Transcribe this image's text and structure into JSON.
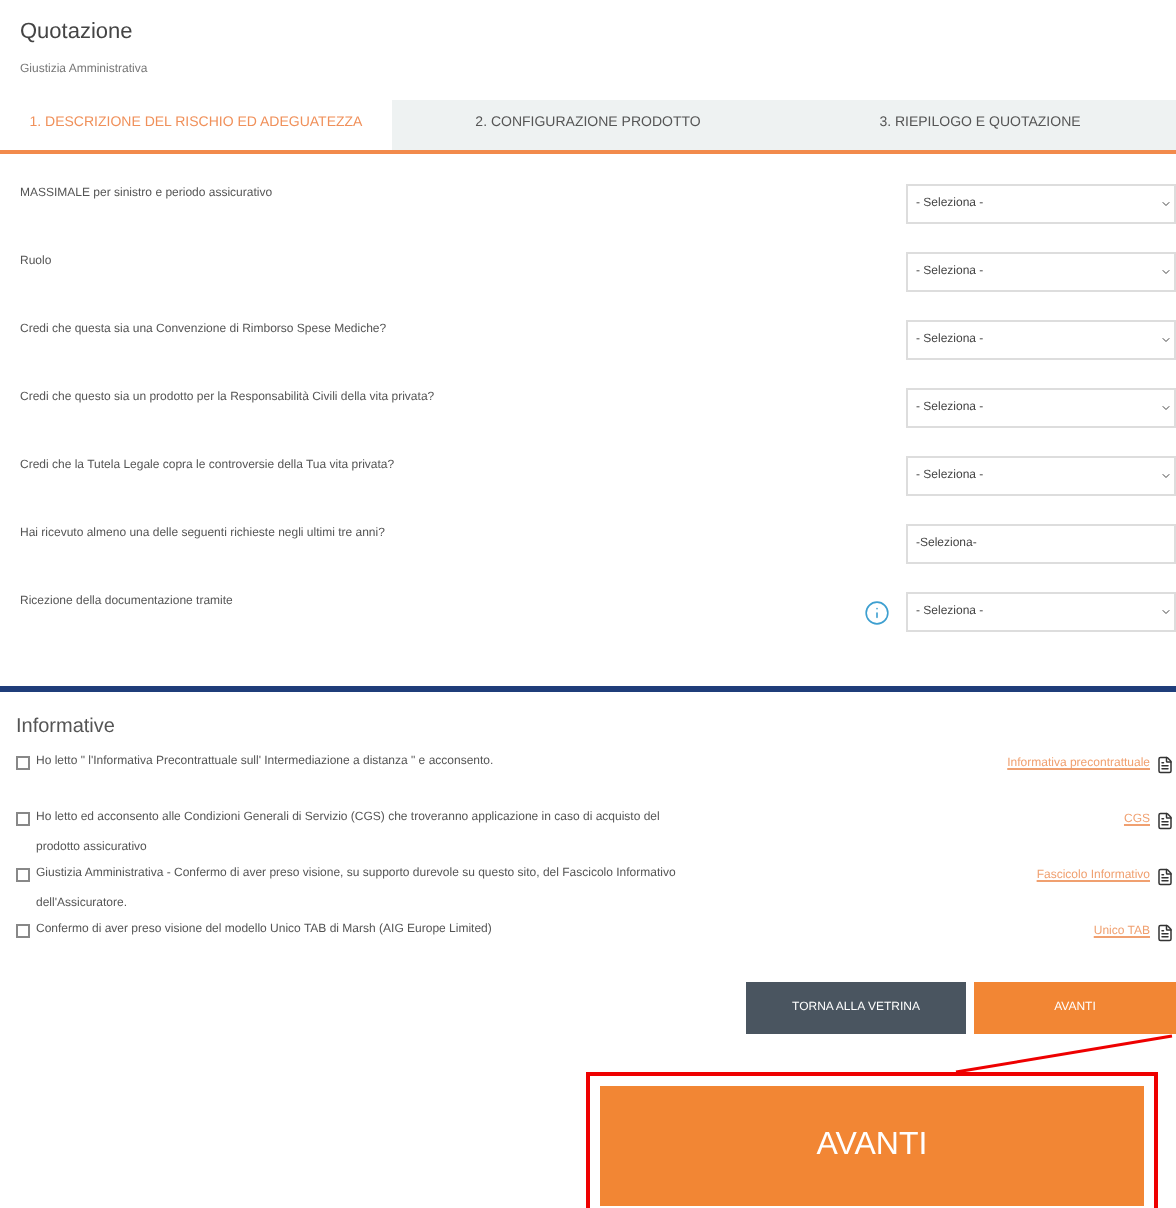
{
  "header": {
    "title": "Quotazione",
    "subtitle": "Giustizia Amministrativa"
  },
  "tabs": [
    {
      "label": "1. DESCRIZIONE DEL RISCHIO ED ADEGUATEZZA",
      "selected": true
    },
    {
      "label": "2. CONFIGURAZIONE PRODOTTO",
      "selected": false
    },
    {
      "label": "3. RIEPILOGO E QUOTAZIONE",
      "selected": false
    }
  ],
  "questions": [
    {
      "label": "MASSIMALE per sinistro e periodo assicurativo",
      "kind": "dropdown",
      "value": "- Seleziona -",
      "info": false
    },
    {
      "label": "Ruolo",
      "kind": "dropdown",
      "value": "- Seleziona -",
      "info": false
    },
    {
      "label": "Credi che questa sia una Convenzione di Rimborso Spese Mediche?",
      "kind": "dropdown",
      "value": "- Seleziona -",
      "info": false
    },
    {
      "label": "Credi che questo sia un prodotto per la Responsabilità Civili della vita privata?",
      "kind": "dropdown",
      "value": "- Seleziona -",
      "info": false
    },
    {
      "label": "Credi che la Tutela Legale copra le controversie della Tua vita privata?",
      "kind": "dropdown",
      "value": "- Seleziona -",
      "info": false
    },
    {
      "label": "Hai ricevuto almeno una delle seguenti richieste negli ultimi tre anni?",
      "kind": "plain",
      "value": "-Seleziona-",
      "info": false
    },
    {
      "label": "Ricezione della documentazione tramite",
      "kind": "dropdown",
      "value": "- Seleziona -",
      "info": true
    }
  ],
  "informative": {
    "title": "Informative",
    "items": [
      {
        "text": "Ho letto \" l'Informativa Precontrattuale sull' Intermediazione a distanza \" e acconsento.",
        "checked": false,
        "link": "Informativa precontrattuale"
      },
      {
        "text": "Ho letto ed acconsento alle Condizioni Generali di Servizio (CGS) che troveranno applicazione in caso di acquisto del prodotto assicurativo",
        "checked": false,
        "link": "CGS"
      },
      {
        "text": "Giustizia Amministrativa - Confermo di aver preso visione, su supporto durevole su questo sito, del Fascicolo Informativo dell'Assicuratore.",
        "checked": false,
        "link": "Fascicolo Informativo"
      },
      {
        "text": "Confermo di aver preso visione del modello Unico TAB di Marsh (AIG Europe Limited)",
        "checked": false,
        "link": "Unico TAB"
      }
    ]
  },
  "buttons": [
    {
      "label": "TORNA ALLA VETRINA",
      "kind": "secondary"
    },
    {
      "label": "AVANTI",
      "kind": "primary"
    }
  ],
  "callout": {
    "label": "AVANTI"
  }
}
